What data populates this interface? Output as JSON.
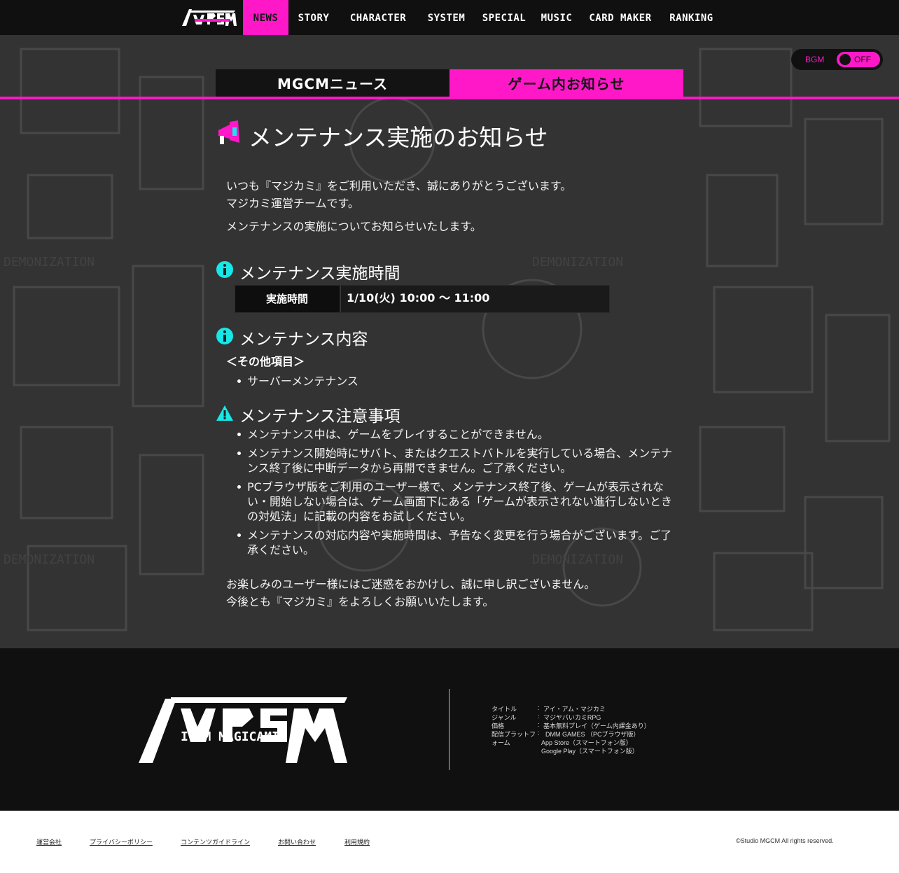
{
  "nav": {
    "items": [
      "NEWS",
      "STORY",
      "CHARACTER",
      "SYSTEM",
      "SPECIAL",
      "MUSIC",
      "CARD MAKER",
      "RANKING"
    ],
    "active": "NEWS"
  },
  "bgm": {
    "label": "BGM",
    "state": "OFF"
  },
  "tabs": [
    "MGCMニュース",
    "ゲーム内お知らせ"
  ],
  "article": {
    "title": "メンテナンス実施のお知らせ",
    "intro_line1": "いつも『マジカミ』をご利用いただき、誠にありがとうございます。",
    "intro_line2": "マジカミ運営チームです。",
    "intro_line3": "メンテナンスの実施についてお知らせいたします。",
    "section_time_title": "メンテナンス実施時間",
    "time_label": "実施時間",
    "time_value": "1/10(火) 10:00 ～ 11:00",
    "section_content_title": "メンテナンス内容",
    "content_subhead": "＜その他項目＞",
    "content_items": [
      "サーバーメンテナンス"
    ],
    "section_notes_title": "メンテナンス注意事項",
    "notes": [
      "メンテナンス中は、ゲームをプレイすることができません。",
      "メンテナンス開始時にサバト、またはクエストバトルを実行している場合、メンテナンス終了後に中断データから再開できません。ご了承ください。",
      "PCブラウザ版をご利用のユーザー様で、メンテナンス終了後、ゲームが表示されない・開始しない場合は、ゲーム画面下にある「ゲームが表示されない進行しないときの対処法」に記載の内容をお試しください。",
      "メンテナンスの対応内容や実施時間は、予告なく変更を行う場合がございます。ご了承ください。"
    ],
    "outro_line1": "お楽しみのユーザー様にはご迷惑をおかけし、誠に申し訳ございません。",
    "outro_line2": "今後とも『マジカミ』をよろしくお願いいたします。"
  },
  "footer": {
    "logo_text": "I AM MAGICAMI",
    "info": [
      {
        "key": "タイトル",
        "value": "アイ・アム・マジカミ"
      },
      {
        "key": "ジャンル",
        "value": "マジヤバいカミRPG"
      },
      {
        "key": "価格",
        "value": "基本無料プレイ（ゲーム内課金あり）"
      },
      {
        "key": "配信プラットフォーム",
        "value": "DMM GAMES （PCブラウザ版）"
      },
      {
        "key": "",
        "value": "App Store（スマートフォン版）"
      },
      {
        "key": "",
        "value": "Google Play（スマートフォン版）"
      }
    ],
    "platform_key_line1": "配信プラットフ",
    "platform_key_line2": "ォーム"
  },
  "bottom": {
    "links": [
      "運営会社",
      "プライバシーポリシー",
      "コンテンツガイドライン",
      "お問い合わせ",
      "利用規約"
    ],
    "copyright": "©Studio MGCM All rights reserved."
  },
  "colors": {
    "accent": "#ff18c8",
    "info_icon": "#19e6e6"
  }
}
